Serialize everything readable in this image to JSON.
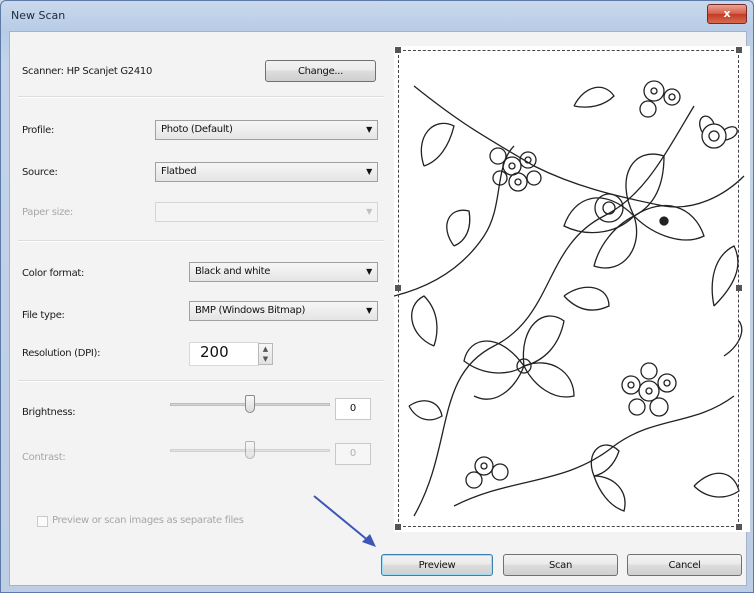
{
  "window": {
    "title": "New Scan",
    "close_glyph": "x"
  },
  "scanner": {
    "label": "Scanner: HP Scanjet G2410",
    "change_button": "Change..."
  },
  "profile": {
    "label": "Profile:",
    "value": "Photo (Default)"
  },
  "source": {
    "label": "Source:",
    "value": "Flatbed"
  },
  "paper_size": {
    "label": "Paper size:",
    "value": ""
  },
  "color_format": {
    "label": "Color format:",
    "value": "Black and white"
  },
  "file_type": {
    "label": "File type:",
    "value": "BMP (Windows Bitmap)"
  },
  "resolution": {
    "label": "Resolution (DPI):",
    "value": "200"
  },
  "brightness": {
    "label": "Brightness:",
    "value": "0",
    "slider_level": 0
  },
  "contrast": {
    "label": "Contrast:",
    "value": "0",
    "slider_level": 0
  },
  "separate_files": {
    "label": "Preview or scan images as separate files",
    "checked": false
  },
  "buttons": {
    "preview": "Preview",
    "scan": "Scan",
    "cancel": "Cancel"
  },
  "preview_image": {
    "subject": "black-and-white floral line-art illustration"
  },
  "annotation": {
    "icon": "arrow-annotation",
    "color": "#3d56b5"
  }
}
